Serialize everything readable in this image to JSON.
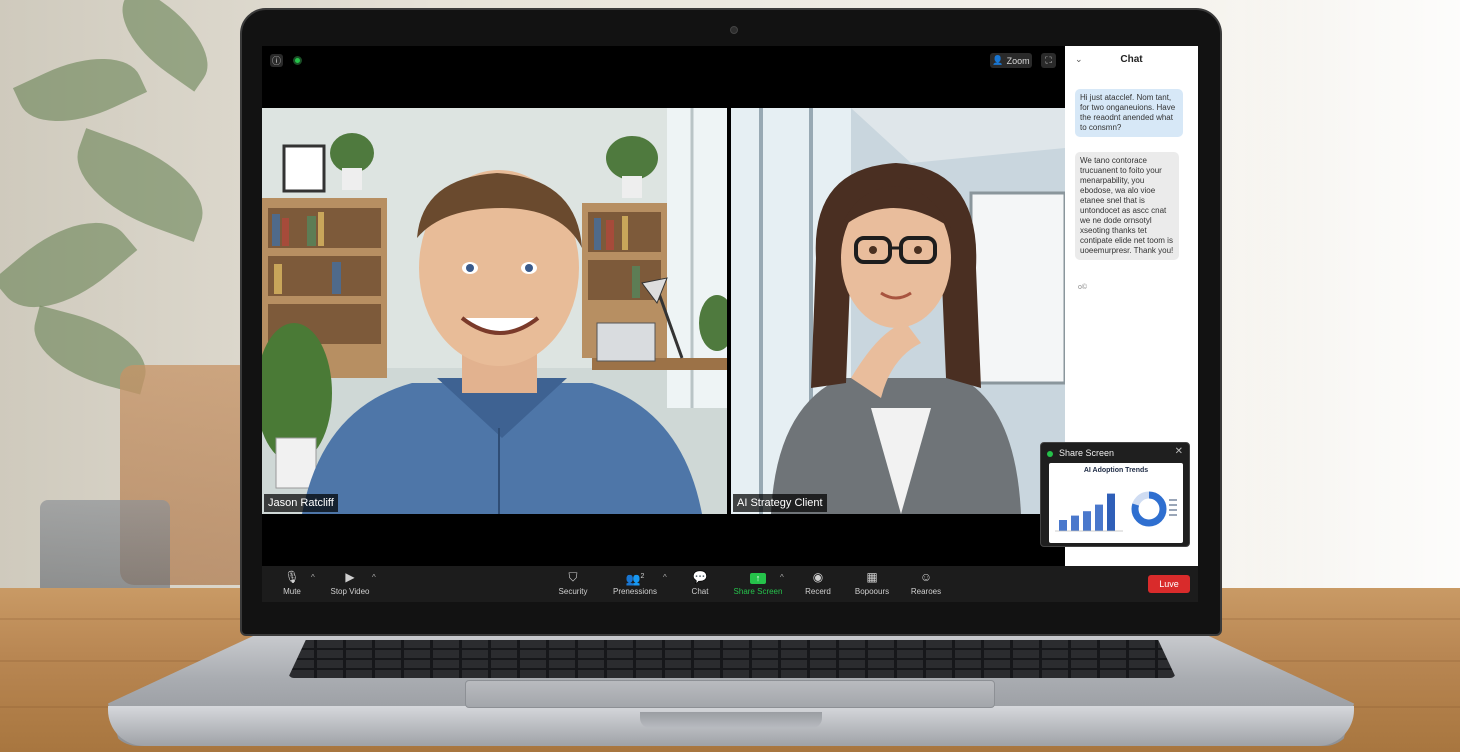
{
  "meeting": {
    "zoom_label": "Zoom"
  },
  "participants": [
    {
      "name": "Jason Ratcliff"
    },
    {
      "name": "AI Strategy Client"
    }
  ],
  "chat": {
    "title": "Chat",
    "messages": [
      {
        "text": "Hi just atacclef. Nom tant, for two onganeuions. Have the reaodnt anended what to consmn?"
      },
      {
        "text": "We tano contorace trucuanent to foito your menarpability, you ebodose, wa alo vioe etanee snel that is untondocet as ascc cnat we ne dode ornsotyl xseoting thanks tet contipate elide net toom is uoeemurpresr. Thank you!"
      }
    ],
    "meta": "o©"
  },
  "share_popup": {
    "title": "Share Screen",
    "preview_title": "AI Adoption Trends",
    "bar_values": [
      0.25,
      0.35,
      0.45,
      0.6,
      0.85
    ],
    "donut_fraction": 0.8
  },
  "toolbar": {
    "mute": "Mute",
    "stop_video": "Stop Video",
    "security": "Security",
    "permissions": "Prenessions",
    "participant_count": "2",
    "chat": "Chat",
    "share_screen": "Share Screen",
    "record": "Recerd",
    "breakouts": "Bopoours",
    "reactions": "Rearoes",
    "leave": "Luve"
  },
  "colors": {
    "accent_green": "#25c24a",
    "leave_red": "#d92b2b",
    "chat_bubble_blue": "#d7e8f7"
  }
}
